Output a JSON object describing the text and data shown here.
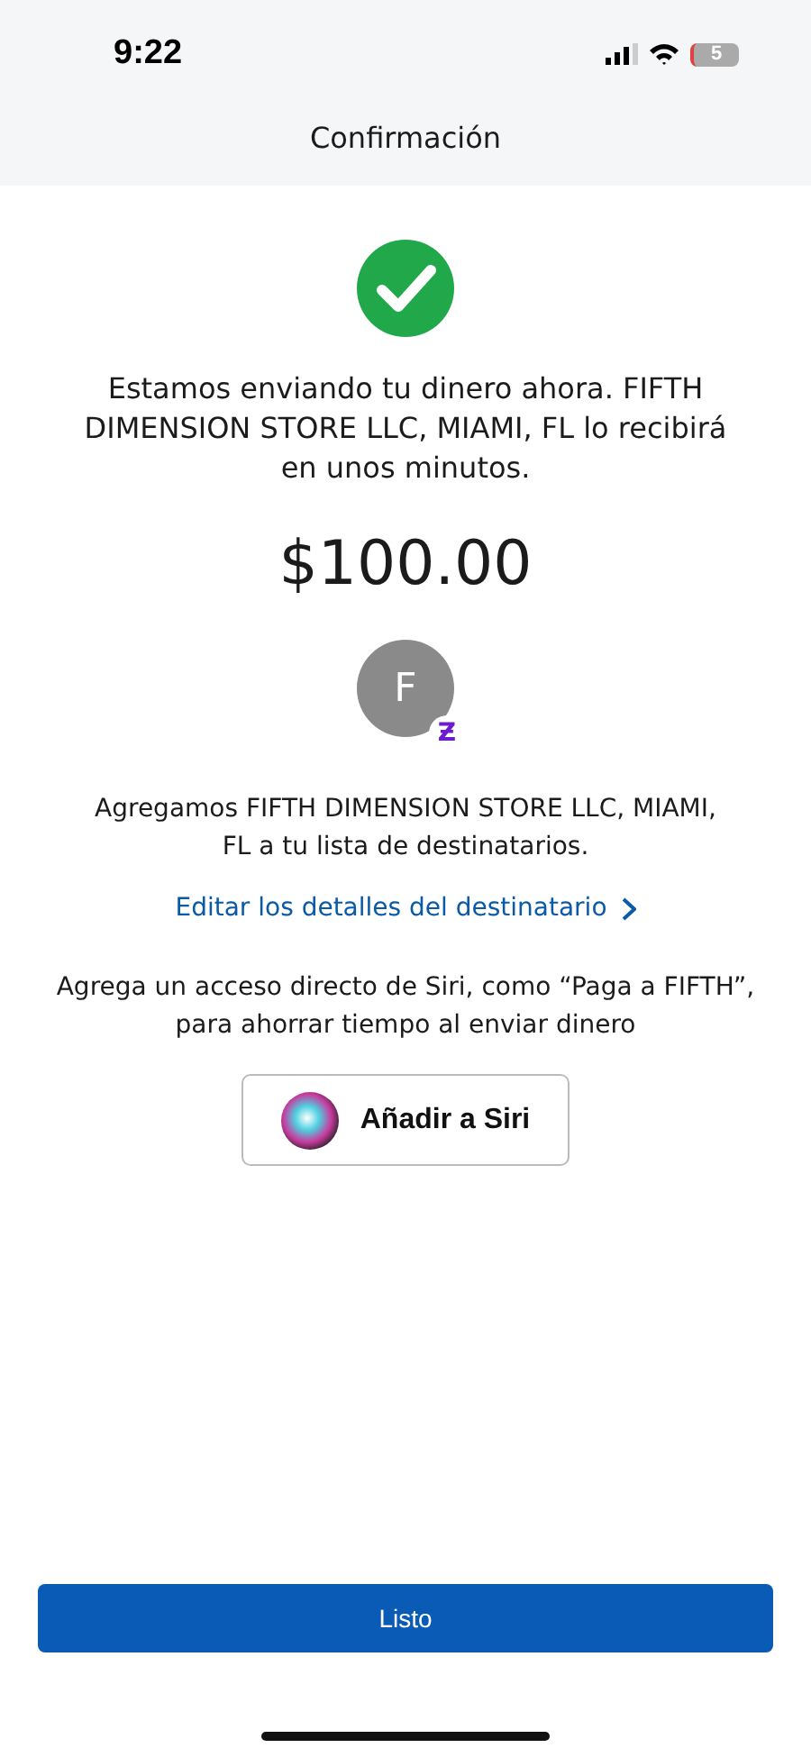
{
  "status_bar": {
    "time": "9:22",
    "battery": "5"
  },
  "header": {
    "title": "Confirmación"
  },
  "message": "Estamos enviando tu dinero ahora. FIFTH DIMENSION STORE LLC, MIAMI, FL lo recibirá en unos minutos.",
  "amount": "$100.00",
  "recipient": {
    "initial": "F",
    "badge": "Ƶ"
  },
  "added_note": "Agregamos FIFTH DIMENSION STORE LLC, MIAMI, FL a tu lista de destinatarios.",
  "edit_link": "Editar los detalles del destinatario",
  "siri_note": "Agrega un acceso directo de Siri, como “Paga a FIFTH”, para ahorrar tiempo al enviar dinero",
  "siri_button": "Añadir a Siri",
  "done_button": "Listo"
}
